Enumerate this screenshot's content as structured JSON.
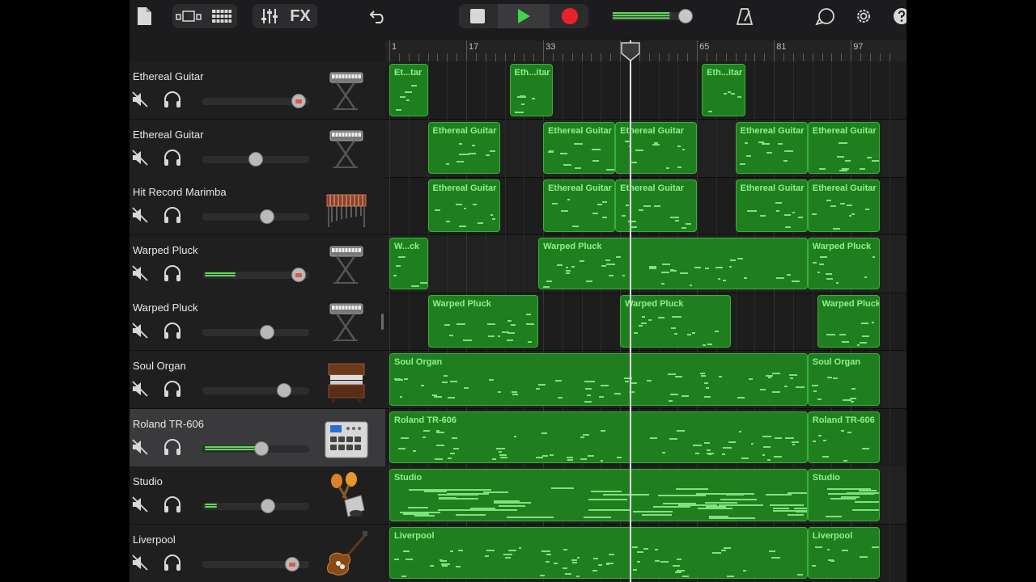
{
  "toolbar": {
    "fx_label": "FX",
    "icons": [
      "my-songs-icon",
      "view-toggle-icon",
      "tracks-view-icon",
      "mixer-icon",
      "fx",
      "undo-icon",
      "stop-icon",
      "play-icon",
      "record-icon",
      "master-volume",
      "metronome-icon",
      "loop-browser-icon",
      "settings-icon",
      "help-icon"
    ],
    "master_volume_level": 0.8,
    "colors": {
      "play": "#43d14f",
      "record": "#e8222b",
      "accent": "#62d95b",
      "region": "#1f7f1f",
      "region_border": "#39b039",
      "region_text": "#8df28a"
    }
  },
  "ruler": {
    "bar_numbers": [
      "1",
      "17",
      "33",
      "49",
      "65",
      "81",
      "97"
    ]
  },
  "tracks": [
    {
      "name": "Ethereal Guitar",
      "instrument": "keyboard-icon",
      "volume": 0.95,
      "level": 0,
      "record": true
    },
    {
      "name": "Ethereal Guitar",
      "instrument": "keyboard-icon",
      "volume": 0.5,
      "level": 0,
      "record": false
    },
    {
      "name": "Hit Record Marimba",
      "instrument": "marimba-icon",
      "volume": 0.62,
      "level": 0,
      "record": false
    },
    {
      "name": "Warped Pluck",
      "instrument": "keyboard-icon",
      "volume": 0.95,
      "level": 0.3,
      "record": true
    },
    {
      "name": "Warped Pluck",
      "instrument": "keyboard-icon",
      "volume": 0.62,
      "level": 0,
      "record": false
    },
    {
      "name": "Soul Organ",
      "instrument": "organ-icon",
      "volume": 0.8,
      "level": 0,
      "record": false
    },
    {
      "name": "Roland TR-606",
      "instrument": "drum-machine-icon",
      "volume": 0.56,
      "level": 0.6,
      "record": false,
      "selected": true
    },
    {
      "name": "Studio",
      "instrument": "percussion-icon",
      "volume": 0.63,
      "level": 0.12,
      "record": false
    },
    {
      "name": "Liverpool",
      "instrument": "bass-guitar-icon",
      "volume": 0.88,
      "level": 0,
      "record": true
    }
  ],
  "regions": [
    [
      {
        "label": "Et...tar",
        "start": 1,
        "end": 9
      },
      {
        "label": "Eth...itar",
        "start": 26,
        "end": 35
      },
      {
        "label": "Eth...itar",
        "start": 66,
        "end": 75
      }
    ],
    [
      {
        "label": "Ethereal Guitar",
        "start": 9,
        "end": 24
      },
      {
        "label": "Ethereal Guitar",
        "start": 33,
        "end": 48
      },
      {
        "label": "Ethereal Guitar",
        "start": 48,
        "end": 65
      },
      {
        "label": "Ethereal Guitar",
        "start": 73,
        "end": 88
      },
      {
        "label": "Ethereal Guitar",
        "start": 88,
        "end": 103
      }
    ],
    [
      {
        "label": "Ethereal Guitar",
        "start": 9,
        "end": 24
      },
      {
        "label": "Ethereal Guitar",
        "start": 33,
        "end": 48
      },
      {
        "label": "Ethereal Guitar",
        "start": 48,
        "end": 65
      },
      {
        "label": "Ethereal Guitar",
        "start": 73,
        "end": 88
      },
      {
        "label": "Ethereal Guitar",
        "start": 88,
        "end": 103
      }
    ],
    [
      {
        "label": "W...ck",
        "start": 1,
        "end": 9
      },
      {
        "label": "Warped Pluck",
        "start": 32,
        "end": 88
      },
      {
        "label": "Warped Pluck",
        "start": 88,
        "end": 103
      }
    ],
    [
      {
        "label": "Warped Pluck",
        "start": 9,
        "end": 32
      },
      {
        "label": "Warped Pluck",
        "start": 49,
        "end": 72
      },
      {
        "label": "Warped Pluck",
        "start": 90,
        "end": 103
      }
    ],
    [
      {
        "label": "Soul Organ",
        "start": 1,
        "end": 88
      },
      {
        "label": "Soul Organ",
        "start": 88,
        "end": 103
      }
    ],
    [
      {
        "label": "Roland TR-606",
        "start": 1,
        "end": 88
      },
      {
        "label": "Roland TR-606",
        "start": 88,
        "end": 103
      }
    ],
    [
      {
        "label": "Studio",
        "start": 1,
        "end": 88
      },
      {
        "label": "Studio",
        "start": 88,
        "end": 103
      }
    ],
    [
      {
        "label": "Liverpool",
        "start": 1,
        "end": 88
      },
      {
        "label": "Liverpool",
        "start": 88,
        "end": 103
      }
    ]
  ],
  "playhead_bar": 51
}
